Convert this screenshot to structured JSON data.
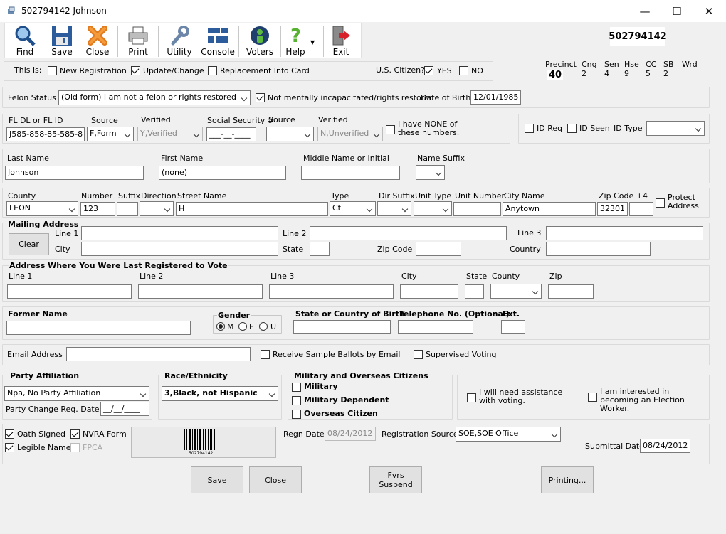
{
  "window": {
    "title": "502794142 Johnson",
    "minimize": "—",
    "maximize": "☐",
    "close": "✕"
  },
  "toolbar": {
    "find": "Find",
    "save": "Save",
    "close": "Close",
    "print": "Print",
    "utility": "Utility",
    "console": "Console",
    "voters": "Voters",
    "help": "Help",
    "exit": "Exit"
  },
  "voter_id": "502794142",
  "districts": {
    "precinct_label": "Precinct",
    "precinct": "40",
    "cng_label": "Cng",
    "cng": "2",
    "sen_label": "Sen",
    "sen": "4",
    "hse_label": "Hse",
    "hse": "9",
    "cc_label": "CC",
    "cc": "5",
    "sb_label": "SB",
    "sb": "2",
    "wrd_label": "Wrd"
  },
  "this_is": {
    "label": "This is:",
    "new_reg": "New Registration",
    "update": "Update/Change",
    "replacement": "Replacement Info Card",
    "citizen_label": "U.S. Citizen?",
    "yes": "YES",
    "no": "NO"
  },
  "felon": {
    "label": "Felon Status",
    "value": "(Old form) I am not a felon or rights restored",
    "mental": "Not mentally incapacitated/rights restored",
    "dob_label": "Date of Birth",
    "dob": "12/01/1985"
  },
  "ids": {
    "dl_label": "FL DL or FL ID",
    "dl": "J585-858-85-585-8",
    "source_label": "Source",
    "source": "F,Form",
    "verified_label": "Verified",
    "verified": "Y,Verified",
    "ssn_label": "Social Security #",
    "ssn": "___-__-____",
    "source2_label": "Source",
    "verified2_label": "Verified",
    "verified2": "N,Unverified",
    "none_label": "I have NONE of these numbers.",
    "id_req": "ID Req",
    "id_seen": "ID Seen",
    "id_type": "ID Type"
  },
  "name": {
    "last_label": "Last Name",
    "last": "Johnson",
    "first_label": "First Name",
    "first": "(none)",
    "middle_label": "Middle Name or Initial",
    "suffix_label": "Name Suffix"
  },
  "address": {
    "county_label": "County",
    "county": "LEON",
    "number_label": "Number",
    "number": "123",
    "suffix_label": "Suffix",
    "direction_label": "Direction",
    "street_label": "Street Name",
    "street": "H",
    "type_label": "Type",
    "type": "Ct",
    "dir_suffix_label": "Dir Suffix",
    "unit_type_label": "Unit Type",
    "unit_number_label": "Unit Number",
    "city_label": "City Name",
    "city": "Anytown",
    "zip_label": "Zip Code +4",
    "zip": "32301",
    "protect": "Protect Address"
  },
  "mailing": {
    "title": "Mailing Address",
    "line1": "Line 1",
    "line2": "Line 2",
    "line3": "Line 3",
    "clear": "Clear",
    "city": "City",
    "state": "State",
    "zip": "Zip Code",
    "country": "Country"
  },
  "last_reg": {
    "title": "Address Where You Were Last Registered to Vote",
    "line1": "Line 1",
    "line2": "Line 2",
    "line3": "Line 3",
    "city": "City",
    "state": "State",
    "county": "County",
    "zip": "Zip"
  },
  "misc": {
    "former_label": "Former Name",
    "gender_label": "Gender",
    "m": "M",
    "f": "F",
    "u": "U",
    "birth_label": "State or Country of Birth",
    "phone_label": "Telephone No. (Optional)",
    "ext_label": "Ext."
  },
  "email": {
    "label": "Email Address",
    "sample": "Receive Sample Ballots by Email",
    "supervised": "Supervised Voting"
  },
  "party": {
    "title": "Party Affiliation",
    "value": "Npa, No Party Affiliation",
    "change_label": "Party Change Req. Date",
    "change": "__/__/____"
  },
  "race": {
    "title": "Race/Ethnicity",
    "value": "3,Black, not Hispanic"
  },
  "military": {
    "title": "Military and Overseas Citizens",
    "military": "Military",
    "dependent": "Military Dependent",
    "overseas": "Overseas Citizen"
  },
  "assist": {
    "assistance": "I will need assistance with voting.",
    "worker": "I am interested in becoming an Election Worker."
  },
  "bottom": {
    "oath": "Oath Signed",
    "nvra": "NVRA Form",
    "legible": "Legible Name",
    "fpca": "FPCA",
    "barcode_text": "502794142",
    "regn_label": "Regn Date",
    "regn": "08/24/2012",
    "source_label": "Registration Source",
    "source": "SOE,SOE Office",
    "submittal_label": "Submittal Date",
    "submittal": "08/24/2012"
  },
  "buttons": {
    "save": "Save",
    "close": "Close",
    "fvrs": "Fvrs Suspend",
    "printing": "Printing..."
  }
}
